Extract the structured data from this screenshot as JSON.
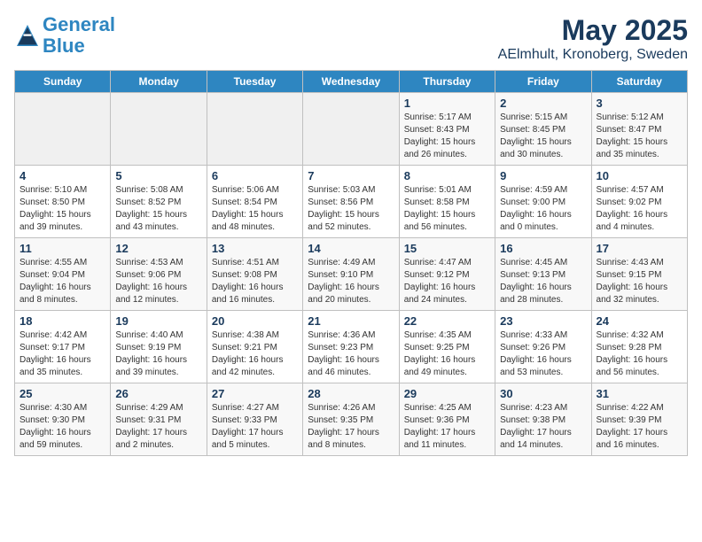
{
  "header": {
    "logo_line1": "General",
    "logo_line2": "Blue",
    "title": "May 2025",
    "subtitle": "AElmhult, Kronoberg, Sweden"
  },
  "days_of_week": [
    "Sunday",
    "Monday",
    "Tuesday",
    "Wednesday",
    "Thursday",
    "Friday",
    "Saturday"
  ],
  "weeks": [
    [
      {
        "num": "",
        "info": ""
      },
      {
        "num": "",
        "info": ""
      },
      {
        "num": "",
        "info": ""
      },
      {
        "num": "",
        "info": ""
      },
      {
        "num": "1",
        "info": "Sunrise: 5:17 AM\nSunset: 8:43 PM\nDaylight: 15 hours\nand 26 minutes."
      },
      {
        "num": "2",
        "info": "Sunrise: 5:15 AM\nSunset: 8:45 PM\nDaylight: 15 hours\nand 30 minutes."
      },
      {
        "num": "3",
        "info": "Sunrise: 5:12 AM\nSunset: 8:47 PM\nDaylight: 15 hours\nand 35 minutes."
      }
    ],
    [
      {
        "num": "4",
        "info": "Sunrise: 5:10 AM\nSunset: 8:50 PM\nDaylight: 15 hours\nand 39 minutes."
      },
      {
        "num": "5",
        "info": "Sunrise: 5:08 AM\nSunset: 8:52 PM\nDaylight: 15 hours\nand 43 minutes."
      },
      {
        "num": "6",
        "info": "Sunrise: 5:06 AM\nSunset: 8:54 PM\nDaylight: 15 hours\nand 48 minutes."
      },
      {
        "num": "7",
        "info": "Sunrise: 5:03 AM\nSunset: 8:56 PM\nDaylight: 15 hours\nand 52 minutes."
      },
      {
        "num": "8",
        "info": "Sunrise: 5:01 AM\nSunset: 8:58 PM\nDaylight: 15 hours\nand 56 minutes."
      },
      {
        "num": "9",
        "info": "Sunrise: 4:59 AM\nSunset: 9:00 PM\nDaylight: 16 hours\nand 0 minutes."
      },
      {
        "num": "10",
        "info": "Sunrise: 4:57 AM\nSunset: 9:02 PM\nDaylight: 16 hours\nand 4 minutes."
      }
    ],
    [
      {
        "num": "11",
        "info": "Sunrise: 4:55 AM\nSunset: 9:04 PM\nDaylight: 16 hours\nand 8 minutes."
      },
      {
        "num": "12",
        "info": "Sunrise: 4:53 AM\nSunset: 9:06 PM\nDaylight: 16 hours\nand 12 minutes."
      },
      {
        "num": "13",
        "info": "Sunrise: 4:51 AM\nSunset: 9:08 PM\nDaylight: 16 hours\nand 16 minutes."
      },
      {
        "num": "14",
        "info": "Sunrise: 4:49 AM\nSunset: 9:10 PM\nDaylight: 16 hours\nand 20 minutes."
      },
      {
        "num": "15",
        "info": "Sunrise: 4:47 AM\nSunset: 9:12 PM\nDaylight: 16 hours\nand 24 minutes."
      },
      {
        "num": "16",
        "info": "Sunrise: 4:45 AM\nSunset: 9:13 PM\nDaylight: 16 hours\nand 28 minutes."
      },
      {
        "num": "17",
        "info": "Sunrise: 4:43 AM\nSunset: 9:15 PM\nDaylight: 16 hours\nand 32 minutes."
      }
    ],
    [
      {
        "num": "18",
        "info": "Sunrise: 4:42 AM\nSunset: 9:17 PM\nDaylight: 16 hours\nand 35 minutes."
      },
      {
        "num": "19",
        "info": "Sunrise: 4:40 AM\nSunset: 9:19 PM\nDaylight: 16 hours\nand 39 minutes."
      },
      {
        "num": "20",
        "info": "Sunrise: 4:38 AM\nSunset: 9:21 PM\nDaylight: 16 hours\nand 42 minutes."
      },
      {
        "num": "21",
        "info": "Sunrise: 4:36 AM\nSunset: 9:23 PM\nDaylight: 16 hours\nand 46 minutes."
      },
      {
        "num": "22",
        "info": "Sunrise: 4:35 AM\nSunset: 9:25 PM\nDaylight: 16 hours\nand 49 minutes."
      },
      {
        "num": "23",
        "info": "Sunrise: 4:33 AM\nSunset: 9:26 PM\nDaylight: 16 hours\nand 53 minutes."
      },
      {
        "num": "24",
        "info": "Sunrise: 4:32 AM\nSunset: 9:28 PM\nDaylight: 16 hours\nand 56 minutes."
      }
    ],
    [
      {
        "num": "25",
        "info": "Sunrise: 4:30 AM\nSunset: 9:30 PM\nDaylight: 16 hours\nand 59 minutes."
      },
      {
        "num": "26",
        "info": "Sunrise: 4:29 AM\nSunset: 9:31 PM\nDaylight: 17 hours\nand 2 minutes."
      },
      {
        "num": "27",
        "info": "Sunrise: 4:27 AM\nSunset: 9:33 PM\nDaylight: 17 hours\nand 5 minutes."
      },
      {
        "num": "28",
        "info": "Sunrise: 4:26 AM\nSunset: 9:35 PM\nDaylight: 17 hours\nand 8 minutes."
      },
      {
        "num": "29",
        "info": "Sunrise: 4:25 AM\nSunset: 9:36 PM\nDaylight: 17 hours\nand 11 minutes."
      },
      {
        "num": "30",
        "info": "Sunrise: 4:23 AM\nSunset: 9:38 PM\nDaylight: 17 hours\nand 14 minutes."
      },
      {
        "num": "31",
        "info": "Sunrise: 4:22 AM\nSunset: 9:39 PM\nDaylight: 17 hours\nand 16 minutes."
      }
    ]
  ]
}
